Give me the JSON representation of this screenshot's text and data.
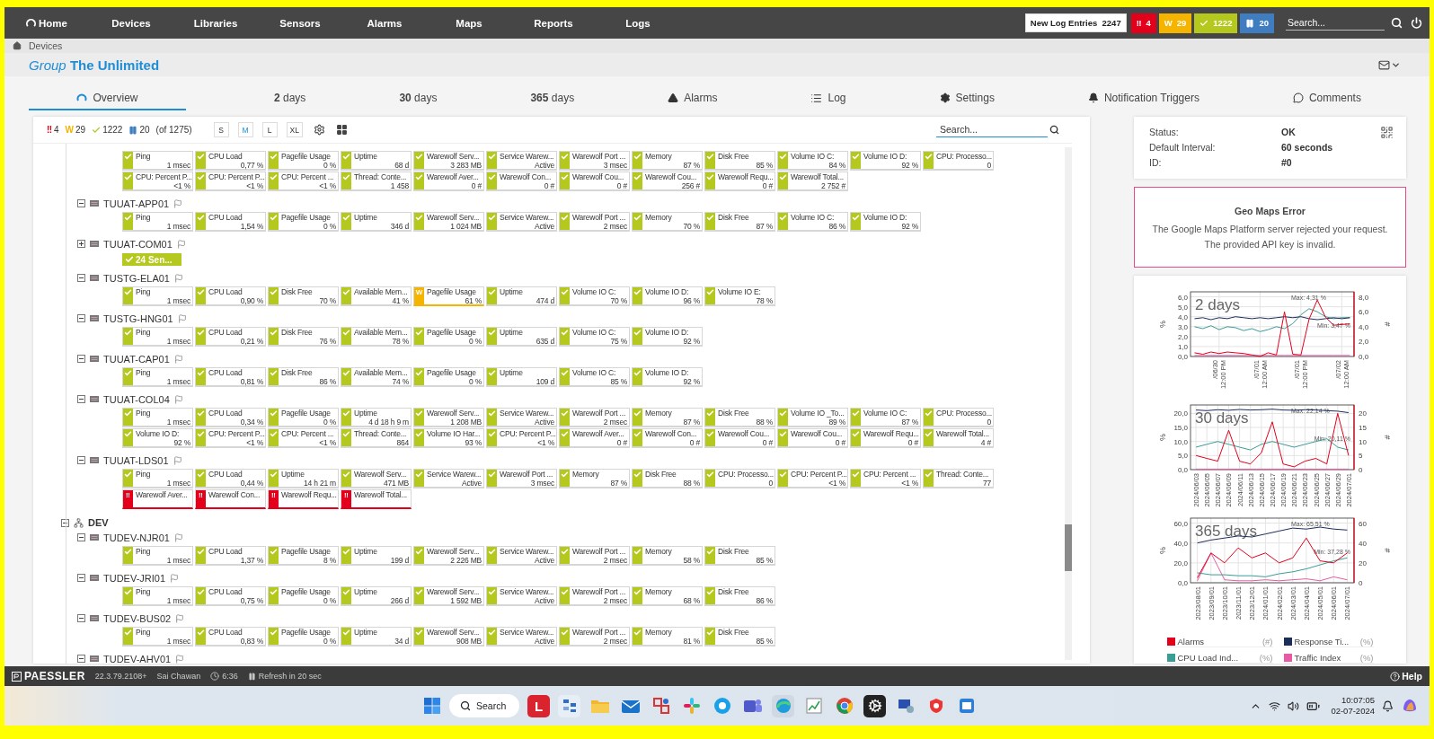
{
  "nav": {
    "home": "Home",
    "items": [
      "Devices",
      "Libraries",
      "Sensors",
      "Alarms",
      "Maps",
      "Reports",
      "Logs"
    ],
    "log_entries": {
      "label": "New Log Entries",
      "count": "2247"
    },
    "status_badges": [
      {
        "kind": "down",
        "symbol": "‼",
        "count": "4"
      },
      {
        "kind": "warning",
        "symbol": "W",
        "count": "29"
      },
      {
        "kind": "up",
        "count": "1222"
      },
      {
        "kind": "paused",
        "count": "20"
      }
    ],
    "search": {
      "placeholder": "Search..."
    }
  },
  "breadcrumb": [
    "Devices"
  ],
  "title": "*Group* **The Unlimited**",
  "tabs": [
    {
      "label": "Overview",
      "kind": "overview",
      "selected": true
    },
    {
      "label": "**2** days",
      "kind": "period",
      "selected": false
    },
    {
      "label": "**30** days",
      "kind": "period",
      "selected": false
    },
    {
      "label": "**365** days",
      "kind": "period",
      "selected": false
    },
    {
      "label": "Alarms",
      "kind": "alarms",
      "selected": false
    },
    {
      "label": "Log",
      "kind": "log",
      "selected": false
    },
    {
      "label": "Settings",
      "kind": "settings",
      "selected": false
    },
    {
      "label": "Notification Triggers",
      "kind": "triggers",
      "selected": false
    },
    {
      "label": "Comments",
      "kind": "comments",
      "selected": false
    }
  ],
  "toolbar": {
    "status_badges": [
      {
        "kind": "down",
        "symbol": "‼",
        "count": "4"
      },
      {
        "kind": "warning",
        "symbol": "W",
        "count": "29"
      },
      {
        "kind": "up",
        "count": "1222"
      },
      {
        "kind": "paused",
        "count": "20"
      }
    ],
    "total": "(of 1275)",
    "sizes": [
      {
        "label": "S",
        "selected": false
      },
      {
        "label": "M",
        "selected": true
      },
      {
        "label": "L",
        "selected": false
      },
      {
        "label": "XL",
        "selected": false
      }
    ],
    "search": {
      "placeholder": "Search..."
    }
  },
  "tree": [
    {
      "devices": [
        {
          "sensors": [
            {
              "name": "Ping",
              "value": "1 msec",
              "kind": "up"
            },
            {
              "name": "CPU Load",
              "value": "0,77 %",
              "kind": "up"
            },
            {
              "name": "Pagefile Usage",
              "value": "0 %",
              "kind": "up"
            },
            {
              "name": "Uptime",
              "value": "68 d",
              "kind": "up"
            },
            {
              "name": "Warewolf Serv...",
              "value": "3 283 MB",
              "kind": "up"
            },
            {
              "name": "Service Warew...",
              "value": "Active",
              "kind": "up"
            },
            {
              "name": "Warewolf Port ...",
              "value": "3 msec",
              "kind": "up"
            },
            {
              "name": "Memory",
              "value": "87 %",
              "kind": "up"
            },
            {
              "name": "Disk Free",
              "value": "85 %",
              "kind": "up"
            },
            {
              "name": "Volume IO C:",
              "value": "84 %",
              "kind": "up"
            },
            {
              "name": "Volume IO D:",
              "value": "92 %",
              "kind": "up"
            },
            {
              "name": "CPU: Processo...",
              "value": "0",
              "kind": "up"
            },
            {
              "name": "CPU: Percent P...",
              "value": "<1 %",
              "kind": "up"
            },
            {
              "name": "CPU: Percent P...",
              "value": "<1 %",
              "kind": "up"
            },
            {
              "name": "CPU: Percent ...",
              "value": "<1 %",
              "kind": "up"
            },
            {
              "name": "Thread: Conte...",
              "value": "1 458",
              "kind": "up"
            },
            {
              "name": "Warewolf Aver...",
              "value": "0 #",
              "kind": "up"
            },
            {
              "name": "Warewolf Con...",
              "value": "0 #",
              "kind": "up"
            },
            {
              "name": "Warewolf Cou...",
              "value": "0 #",
              "kind": "up"
            },
            {
              "name": "Warewolf Cou...",
              "value": "256 #",
              "kind": "up"
            },
            {
              "name": "Warewolf Requ...",
              "value": "0 #",
              "kind": "up"
            },
            {
              "name": "Warewolf Total...",
              "value": "2 752 #",
              "kind": "up"
            }
          ]
        },
        {
          "name": "TUUAT-APP01",
          "expanded": true,
          "sensors": [
            {
              "name": "Ping",
              "value": "1 msec",
              "kind": "up"
            },
            {
              "name": "CPU Load",
              "value": "1,54 %",
              "kind": "up"
            },
            {
              "name": "Pagefile Usage",
              "value": "0 %",
              "kind": "up"
            },
            {
              "name": "Uptime",
              "value": "346 d",
              "kind": "up"
            },
            {
              "name": "Warewolf Serv...",
              "value": "1 024 MB",
              "kind": "up"
            },
            {
              "name": "Service Warew...",
              "value": "Active",
              "kind": "up"
            },
            {
              "name": "Warewolf Port ...",
              "value": "2 msec",
              "kind": "up"
            },
            {
              "name": "Memory",
              "value": "70 %",
              "kind": "up"
            },
            {
              "name": "Disk Free",
              "value": "87 %",
              "kind": "up"
            },
            {
              "name": "Volume IO C:",
              "value": "86 %",
              "kind": "up"
            },
            {
              "name": "Volume IO D:",
              "value": "92 %",
              "kind": "up"
            }
          ]
        },
        {
          "name": "TUUAT-COM01",
          "expanded": false,
          "summary": "24 Sen..."
        },
        {
          "name": "TUSTG-ELA01",
          "expanded": true,
          "sensors": [
            {
              "name": "Ping",
              "value": "1 msec",
              "kind": "up"
            },
            {
              "name": "CPU Load",
              "value": "0,90 %",
              "kind": "up"
            },
            {
              "name": "Disk Free",
              "value": "70 %",
              "kind": "up"
            },
            {
              "name": "Available Mem...",
              "value": "41 %",
              "kind": "up"
            },
            {
              "name": "Pagefile Usage",
              "value": "61 %",
              "kind": "warning",
              "mark": "W"
            },
            {
              "name": "Uptime",
              "value": "474 d",
              "kind": "up"
            },
            {
              "name": "Volume IO C:",
              "value": "70 %",
              "kind": "up"
            },
            {
              "name": "Volume IO D:",
              "value": "96 %",
              "kind": "up"
            },
            {
              "name": "Volume IO E:",
              "value": "78 %",
              "kind": "up"
            }
          ]
        },
        {
          "name": "TUSTG-HNG01",
          "expanded": true,
          "sensors": [
            {
              "name": "Ping",
              "value": "1 msec",
              "kind": "up"
            },
            {
              "name": "CPU Load",
              "value": "0,21 %",
              "kind": "up"
            },
            {
              "name": "Disk Free",
              "value": "76 %",
              "kind": "up"
            },
            {
              "name": "Available Mem...",
              "value": "78 %",
              "kind": "up"
            },
            {
              "name": "Pagefile Usage",
              "value": "0 %",
              "kind": "up"
            },
            {
              "name": "Uptime",
              "value": "635 d",
              "kind": "up"
            },
            {
              "name": "Volume IO C:",
              "value": "75 %",
              "kind": "up"
            },
            {
              "name": "Volume IO D:",
              "value": "92 %",
              "kind": "up"
            }
          ]
        },
        {
          "name": "TUUAT-CAP01",
          "expanded": true,
          "sensors": [
            {
              "name": "Ping",
              "value": "1 msec",
              "kind": "up"
            },
            {
              "name": "CPU Load",
              "value": "0,81 %",
              "kind": "up"
            },
            {
              "name": "Disk Free",
              "value": "86 %",
              "kind": "up"
            },
            {
              "name": "Available Mem...",
              "value": "74 %",
              "kind": "up"
            },
            {
              "name": "Pagefile Usage",
              "value": "0 %",
              "kind": "up"
            },
            {
              "name": "Uptime",
              "value": "109 d",
              "kind": "up"
            },
            {
              "name": "Volume IO C:",
              "value": "85 %",
              "kind": "up"
            },
            {
              "name": "Volume IO D:",
              "value": "92 %",
              "kind": "up"
            }
          ]
        },
        {
          "name": "TUUAT-COL04",
          "expanded": true,
          "sensors": [
            {
              "name": "Ping",
              "value": "1 msec",
              "kind": "up"
            },
            {
              "name": "CPU Load",
              "value": "0,34 %",
              "kind": "up"
            },
            {
              "name": "Pagefile Usage",
              "value": "0 %",
              "kind": "up"
            },
            {
              "name": "Uptime",
              "value": "4 d 18 h 9 m",
              "kind": "up"
            },
            {
              "name": "Warewolf Serv...",
              "value": "1 208 MB",
              "kind": "up"
            },
            {
              "name": "Service Warew...",
              "value": "Active",
              "kind": "up"
            },
            {
              "name": "Warewolf Port ...",
              "value": "2 msec",
              "kind": "up"
            },
            {
              "name": "Memory",
              "value": "87 %",
              "kind": "up"
            },
            {
              "name": "Disk Free",
              "value": "88 %",
              "kind": "up"
            },
            {
              "name": "Volume IO _To...",
              "value": "89 %",
              "kind": "up"
            },
            {
              "name": "Volume IO C:",
              "value": "87 %",
              "kind": "up"
            },
            {
              "name": "CPU: Processo...",
              "value": "0",
              "kind": "up"
            },
            {
              "name": "Volume IO D:",
              "value": "92 %",
              "kind": "up"
            },
            {
              "name": "CPU: Percent P...",
              "value": "<1 %",
              "kind": "up"
            },
            {
              "name": "CPU: Percent ...",
              "value": "<1 %",
              "kind": "up"
            },
            {
              "name": "Thread: Conte...",
              "value": "864",
              "kind": "up"
            },
            {
              "name": "Volume IO Har...",
              "value": "93 %",
              "kind": "up"
            },
            {
              "name": "CPU: Percent P...",
              "value": "<1 %",
              "kind": "up"
            },
            {
              "name": "Warewolf Aver...",
              "value": "0 #",
              "kind": "up"
            },
            {
              "name": "Warewolf Con...",
              "value": "0 #",
              "kind": "up"
            },
            {
              "name": "Warewolf Cou...",
              "value": "0 #",
              "kind": "up"
            },
            {
              "name": "Warewolf Cou...",
              "value": "0 #",
              "kind": "up"
            },
            {
              "name": "Warewolf Requ...",
              "value": "0 #",
              "kind": "up"
            },
            {
              "name": "Warewolf Total...",
              "value": "4 #",
              "kind": "up"
            }
          ]
        },
        {
          "name": "TUUAT-LDS01",
          "expanded": true,
          "sensors": [
            {
              "name": "Ping",
              "value": "1 msec",
              "kind": "up"
            },
            {
              "name": "CPU Load",
              "value": "0,44 %",
              "kind": "up"
            },
            {
              "name": "Uptime",
              "value": "14 h 21 m",
              "kind": "up"
            },
            {
              "name": "Warewolf Serv...",
              "value": "471 MB",
              "kind": "up"
            },
            {
              "name": "Service Warew...",
              "value": "Active",
              "kind": "up"
            },
            {
              "name": "Warewolf Port ...",
              "value": "3 msec",
              "kind": "up"
            },
            {
              "name": "Memory",
              "value": "87 %",
              "kind": "up"
            },
            {
              "name": "Disk Free",
              "value": "88 %",
              "kind": "up"
            },
            {
              "name": "CPU: Processo...",
              "value": "0",
              "kind": "up"
            },
            {
              "name": "CPU: Percent P...",
              "value": "<1 %",
              "kind": "up"
            },
            {
              "name": "CPU: Percent ...",
              "value": "<1 %",
              "kind": "up"
            },
            {
              "name": "Thread: Conte...",
              "value": "77",
              "kind": "up"
            },
            {
              "name": "Warewolf Aver...",
              "kind": "down",
              "mark": "‼"
            },
            {
              "name": "Warewolf Con...",
              "kind": "down",
              "mark": "‼"
            },
            {
              "name": "Warewolf Requ...",
              "kind": "down",
              "mark": "‼"
            },
            {
              "name": "Warewolf Total...",
              "kind": "down",
              "mark": "‼"
            }
          ]
        }
      ]
    },
    {
      "name": "DEV",
      "expanded": true,
      "devices": [
        {
          "name": "TUDEV-NJR01",
          "expanded": true,
          "sensors": [
            {
              "name": "Ping",
              "value": "1 msec",
              "kind": "up"
            },
            {
              "name": "CPU Load",
              "value": "1,37 %",
              "kind": "up"
            },
            {
              "name": "Pagefile Usage",
              "value": "8 %",
              "kind": "up"
            },
            {
              "name": "Uptime",
              "value": "199 d",
              "kind": "up"
            },
            {
              "name": "Warewolf Serv...",
              "value": "2 226 MB",
              "kind": "up"
            },
            {
              "name": "Service Warew...",
              "value": "Active",
              "kind": "up"
            },
            {
              "name": "Warewolf Port ...",
              "value": "2 msec",
              "kind": "up"
            },
            {
              "name": "Memory",
              "value": "58 %",
              "kind": "up"
            },
            {
              "name": "Disk Free",
              "value": "85 %",
              "kind": "up"
            }
          ]
        },
        {
          "name": "TUDEV-JRI01",
          "expanded": true,
          "sensors": [
            {
              "name": "Ping",
              "value": "1 msec",
              "kind": "up"
            },
            {
              "name": "CPU Load",
              "value": "0,75 %",
              "kind": "up"
            },
            {
              "name": "Pagefile Usage",
              "value": "0 %",
              "kind": "up"
            },
            {
              "name": "Uptime",
              "value": "266 d",
              "kind": "up"
            },
            {
              "name": "Warewolf Serv...",
              "value": "1 592 MB",
              "kind": "up"
            },
            {
              "name": "Service Warew...",
              "value": "Active",
              "kind": "up"
            },
            {
              "name": "Warewolf Port ...",
              "value": "2 msec",
              "kind": "up"
            },
            {
              "name": "Memory",
              "value": "68 %",
              "kind": "up"
            },
            {
              "name": "Disk Free",
              "value": "86 %",
              "kind": "up"
            }
          ]
        },
        {
          "name": "TUDEV-BUS02",
          "expanded": true,
          "sensors": [
            {
              "name": "Ping",
              "value": "1 msec",
              "kind": "up"
            },
            {
              "name": "CPU Load",
              "value": "0,83 %",
              "kind": "up"
            },
            {
              "name": "Pagefile Usage",
              "value": "0 %",
              "kind": "up"
            },
            {
              "name": "Uptime",
              "value": "34 d",
              "kind": "up"
            },
            {
              "name": "Warewolf Serv...",
              "value": "908 MB",
              "kind": "up"
            },
            {
              "name": "Service Warew...",
              "value": "Active",
              "kind": "up"
            },
            {
              "name": "Warewolf Port ...",
              "value": "2 msec",
              "kind": "up"
            },
            {
              "name": "Memory",
              "value": "81 %",
              "kind": "up"
            },
            {
              "name": "Disk Free",
              "value": "85 %",
              "kind": "up"
            }
          ]
        },
        {
          "name": "TUDEV-AHV01",
          "expanded": true
        }
      ]
    }
  ],
  "info": [
    {
      "label": "Status:",
      "value": "OK"
    },
    {
      "label": "Default Interval:",
      "value": "60 seconds"
    },
    {
      "label": "ID:",
      "value": "#0"
    }
  ],
  "geo_error": {
    "title": "Geo Maps Error",
    "lines": [
      "The Google Maps Platform server rejected your request.",
      "The provided API key is invalid."
    ]
  },
  "charts": [
    {
      "chart_data": {
        "type": "line",
        "title": "2 days",
        "ylabel": "%",
        "categories": [
          null,
          null,
          null,
          "/06/30 12:00 PM",
          null,
          null,
          null,
          null,
          "/07/01 12:00 AM",
          null,
          null,
          null,
          null,
          "/07/01 12:00 PM",
          null,
          null,
          null,
          null,
          "/07/02 12:00 AM",
          null
        ],
        "ylim": [
          0,
          6.5
        ],
        "yticks": [
          {
            "value": 0,
            "label": "0,0"
          },
          {
            "value": 1,
            "label": "1,0"
          },
          {
            "value": 2,
            "label": "2,0"
          },
          {
            "value": 3,
            "label": "3,0"
          },
          {
            "value": 4,
            "label": "4,0"
          },
          {
            "value": 5,
            "label": "5,0"
          },
          {
            "value": 6,
            "label": "6,0"
          }
        ],
        "series": [
          {
            "color": "#e85aa5",
            "values": [
              0.1,
              0.1,
              0.1,
              0.1,
              0.1,
              0.1,
              0.1,
              0.1,
              0.1,
              0.1,
              0.1,
              0.1,
              0.1,
              0.1,
              0.1,
              0.1,
              0.1,
              0.1,
              0.1,
              0.1
            ]
          },
          {
            "color": "#3a9e96",
            "values": [
              3.0,
              2.8,
              3.1,
              2.7,
              3.0,
              2.9,
              2.6,
              2.8,
              2.5,
              2.7,
              3.0,
              2.8,
              3.3,
              4.2,
              4.8,
              4.5,
              4.0,
              3.8,
              3.9,
              3.9
            ]
          },
          {
            "color": "#1c2d5a",
            "values": [
              3.8,
              3.9,
              3.7,
              3.9,
              3.8,
              4.0,
              3.9,
              3.8,
              3.9,
              3.8,
              3.9,
              4.0,
              3.9,
              4.0,
              3.8,
              3.7,
              3.8,
              3.9,
              3.8,
              3.9
            ]
          },
          {
            "color": "#e3001b",
            "axis": "y2",
            "values": [
              0.5,
              0.3,
              0.6,
              0.4,
              0.6,
              0.5,
              0.4,
              0.2,
              0.0,
              0.5,
              0.2,
              6.0,
              0.3,
              0.2,
              5.0,
              7.6,
              5.3,
              4.2,
              4.3,
              4.4
            ]
          }
        ],
        "annotations": [
          "Max: 4,31 %",
          "Min: 3,47 %"
        ],
        "grid": true,
        "y2label": "#",
        "y2lim": [
          0,
          8.7
        ],
        "y2ticks": [
          {
            "value": 0,
            "label": "0,0"
          },
          {
            "value": 2,
            "label": "2,0"
          },
          {
            "value": 4,
            "label": "4,0"
          },
          {
            "value": 6,
            "label": "6,0"
          },
          {
            "value": 8,
            "label": "8,0"
          }
        ]
      }
    },
    {
      "chart_data": {
        "type": "line",
        "title": "30 days",
        "ylabel": "%",
        "categories": [
          "2024/06/03",
          "2024/06/05",
          "2024/06/07",
          "2024/06/09",
          "2024/06/11",
          "2024/06/13",
          "2024/06/15",
          "2024/06/17",
          "2024/06/19",
          "2024/06/21",
          "2024/06/23",
          "2024/06/25",
          "2024/06/27",
          "2024/06/29",
          "2024/07/01"
        ],
        "ylim": [
          0,
          23
        ],
        "yticks": [
          {
            "value": 0,
            "label": "0,0"
          },
          {
            "value": 5,
            "label": "5,0"
          },
          {
            "value": 10,
            "label": "10,0"
          },
          {
            "value": 15,
            "label": "15,0"
          },
          {
            "value": 20,
            "label": "20,0"
          }
        ],
        "series": [
          {
            "color": "#e85aa5",
            "values": [
              0.2,
              0.2,
              0.2,
              0.2,
              0.2,
              0.2,
              0.2,
              0.2,
              0.2,
              0.2,
              0.2,
              0.2,
              0.2,
              0.2,
              0.2
            ]
          },
          {
            "color": "#3a9e96",
            "values": [
              8,
              9,
              10,
              9,
              8,
              7,
              9,
              10,
              9,
              8,
              9,
              10,
              11,
              8,
              7
            ]
          },
          {
            "color": "#1c2d5a",
            "values": [
              21.2,
              21.0,
              21.3,
              21.1,
              21.4,
              21.2,
              21.3,
              21.5,
              21.2,
              21.1,
              21.3,
              21.2,
              21.0,
              20.8,
              20.3
            ]
          },
          {
            "color": "#e3001b",
            "axis": "y2",
            "values": [
              5,
              4,
              3,
              14,
              3,
              2,
              6,
              17,
              2,
              1,
              3,
              4,
              2,
              20,
              5
            ]
          }
        ],
        "annotations": [
          "Max: 22,14 %",
          "Min: 20,11 %"
        ],
        "grid": true,
        "y2label": "#",
        "y2lim": [
          0,
          23
        ],
        "y2ticks": [
          {
            "value": 0,
            "label": "0"
          },
          {
            "value": 5,
            "label": "5"
          },
          {
            "value": 10,
            "label": "10"
          },
          {
            "value": 15,
            "label": "15"
          },
          {
            "value": 20,
            "label": "20"
          }
        ]
      }
    },
    {
      "chart_data": {
        "type": "line",
        "title": "365 days",
        "ylabel": "%",
        "categories": [
          "2023/08/01",
          "2023/09/01",
          "2023/10/01",
          "2023/11/01",
          "2023/12/01",
          "2024/01/01",
          "2024/02/01",
          "2024/03/01",
          "2024/04/01",
          "2024/05/01",
          "2024/06/01",
          "2024/07/01"
        ],
        "ylim": [
          0,
          65
        ],
        "yticks": [
          {
            "value": 0,
            "label": "0,0"
          },
          {
            "value": 20,
            "label": "20,0"
          },
          {
            "value": 40,
            "label": "40,0"
          },
          {
            "value": 60,
            "label": "60,0"
          }
        ],
        "series": [
          {
            "color": "#e85aa5",
            "values": [
              2,
              30,
              3,
              2,
              2,
              3,
              2,
              3,
              4,
              2,
              6,
              3
            ]
          },
          {
            "color": "#3a9e96",
            "values": [
              10,
              8,
              8,
              7,
              7,
              6,
              9,
              11,
              14,
              18,
              22,
              25
            ]
          },
          {
            "color": "#1c2d5a",
            "values": [
              40,
              43,
              45,
              47,
              46,
              49,
              52,
              55,
              54,
              56,
              54,
              53
            ]
          },
          {
            "color": "#e3001b",
            "axis": "y2",
            "values": [
              5,
              30,
              20,
              35,
              25,
              30,
              20,
              25,
              45,
              22,
              20,
              30
            ]
          }
        ],
        "annotations": [
          "Max: 65,51 %",
          "Min: 37,28 %"
        ],
        "grid": true,
        "y2label": "#",
        "y2lim": [
          0,
          65
        ],
        "y2ticks": [
          {
            "value": 0,
            "label": "0"
          },
          {
            "value": 20,
            "label": "20"
          },
          {
            "value": 40,
            "label": "40"
          },
          {
            "value": 60,
            "label": "60"
          }
        ]
      }
    }
  ],
  "legend": [
    {
      "label": "Alarms",
      "unit": "(#)",
      "color": "#e3001b"
    },
    {
      "label": "Response Ti...",
      "unit": "(%)",
      "color": "#1c2d5a"
    },
    {
      "label": "CPU Load Ind...",
      "unit": "(%)",
      "color": "#3a9e96"
    },
    {
      "label": "Traffic Index",
      "unit": "(%)",
      "color": "#e85aa5"
    }
  ],
  "footer": {
    "brand": "PAESSLER",
    "version": "22.3.79.2108+",
    "user": "Sai Chawan",
    "time": "6:36",
    "refresh": "Refresh in 20 sec",
    "help": "Help"
  },
  "taskbar": {
    "search": "Search",
    "app_letter": "L",
    "time": "10:07:05",
    "date": "02-07-2024"
  }
}
